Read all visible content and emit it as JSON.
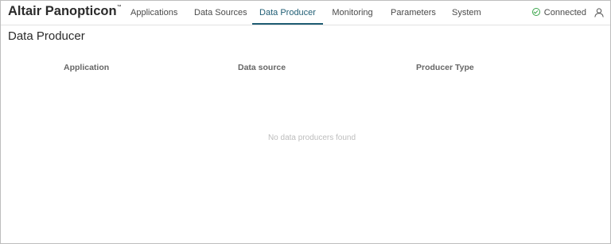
{
  "app": {
    "logo_text": "Altair Panopticon",
    "logo_mark": "™"
  },
  "nav": {
    "items": [
      {
        "label": "Applications",
        "active": false
      },
      {
        "label": "Data Sources",
        "active": false
      },
      {
        "label": "Data Producer",
        "active": true
      },
      {
        "label": "Monitoring",
        "active": false
      },
      {
        "label": "Parameters",
        "active": false
      },
      {
        "label": "System",
        "active": false
      }
    ]
  },
  "status": {
    "label": "Connected",
    "icon": "check-circle-icon",
    "color": "#3aa54a"
  },
  "user": {
    "icon": "user-icon"
  },
  "page": {
    "title": "Data Producer"
  },
  "table": {
    "columns": [
      "Application",
      "Data source",
      "Producer Type"
    ],
    "empty_message": "No data producers found"
  },
  "colors": {
    "accent": "#1f5d74",
    "text": "#2b2b2b",
    "muted": "#bdbdbd"
  }
}
